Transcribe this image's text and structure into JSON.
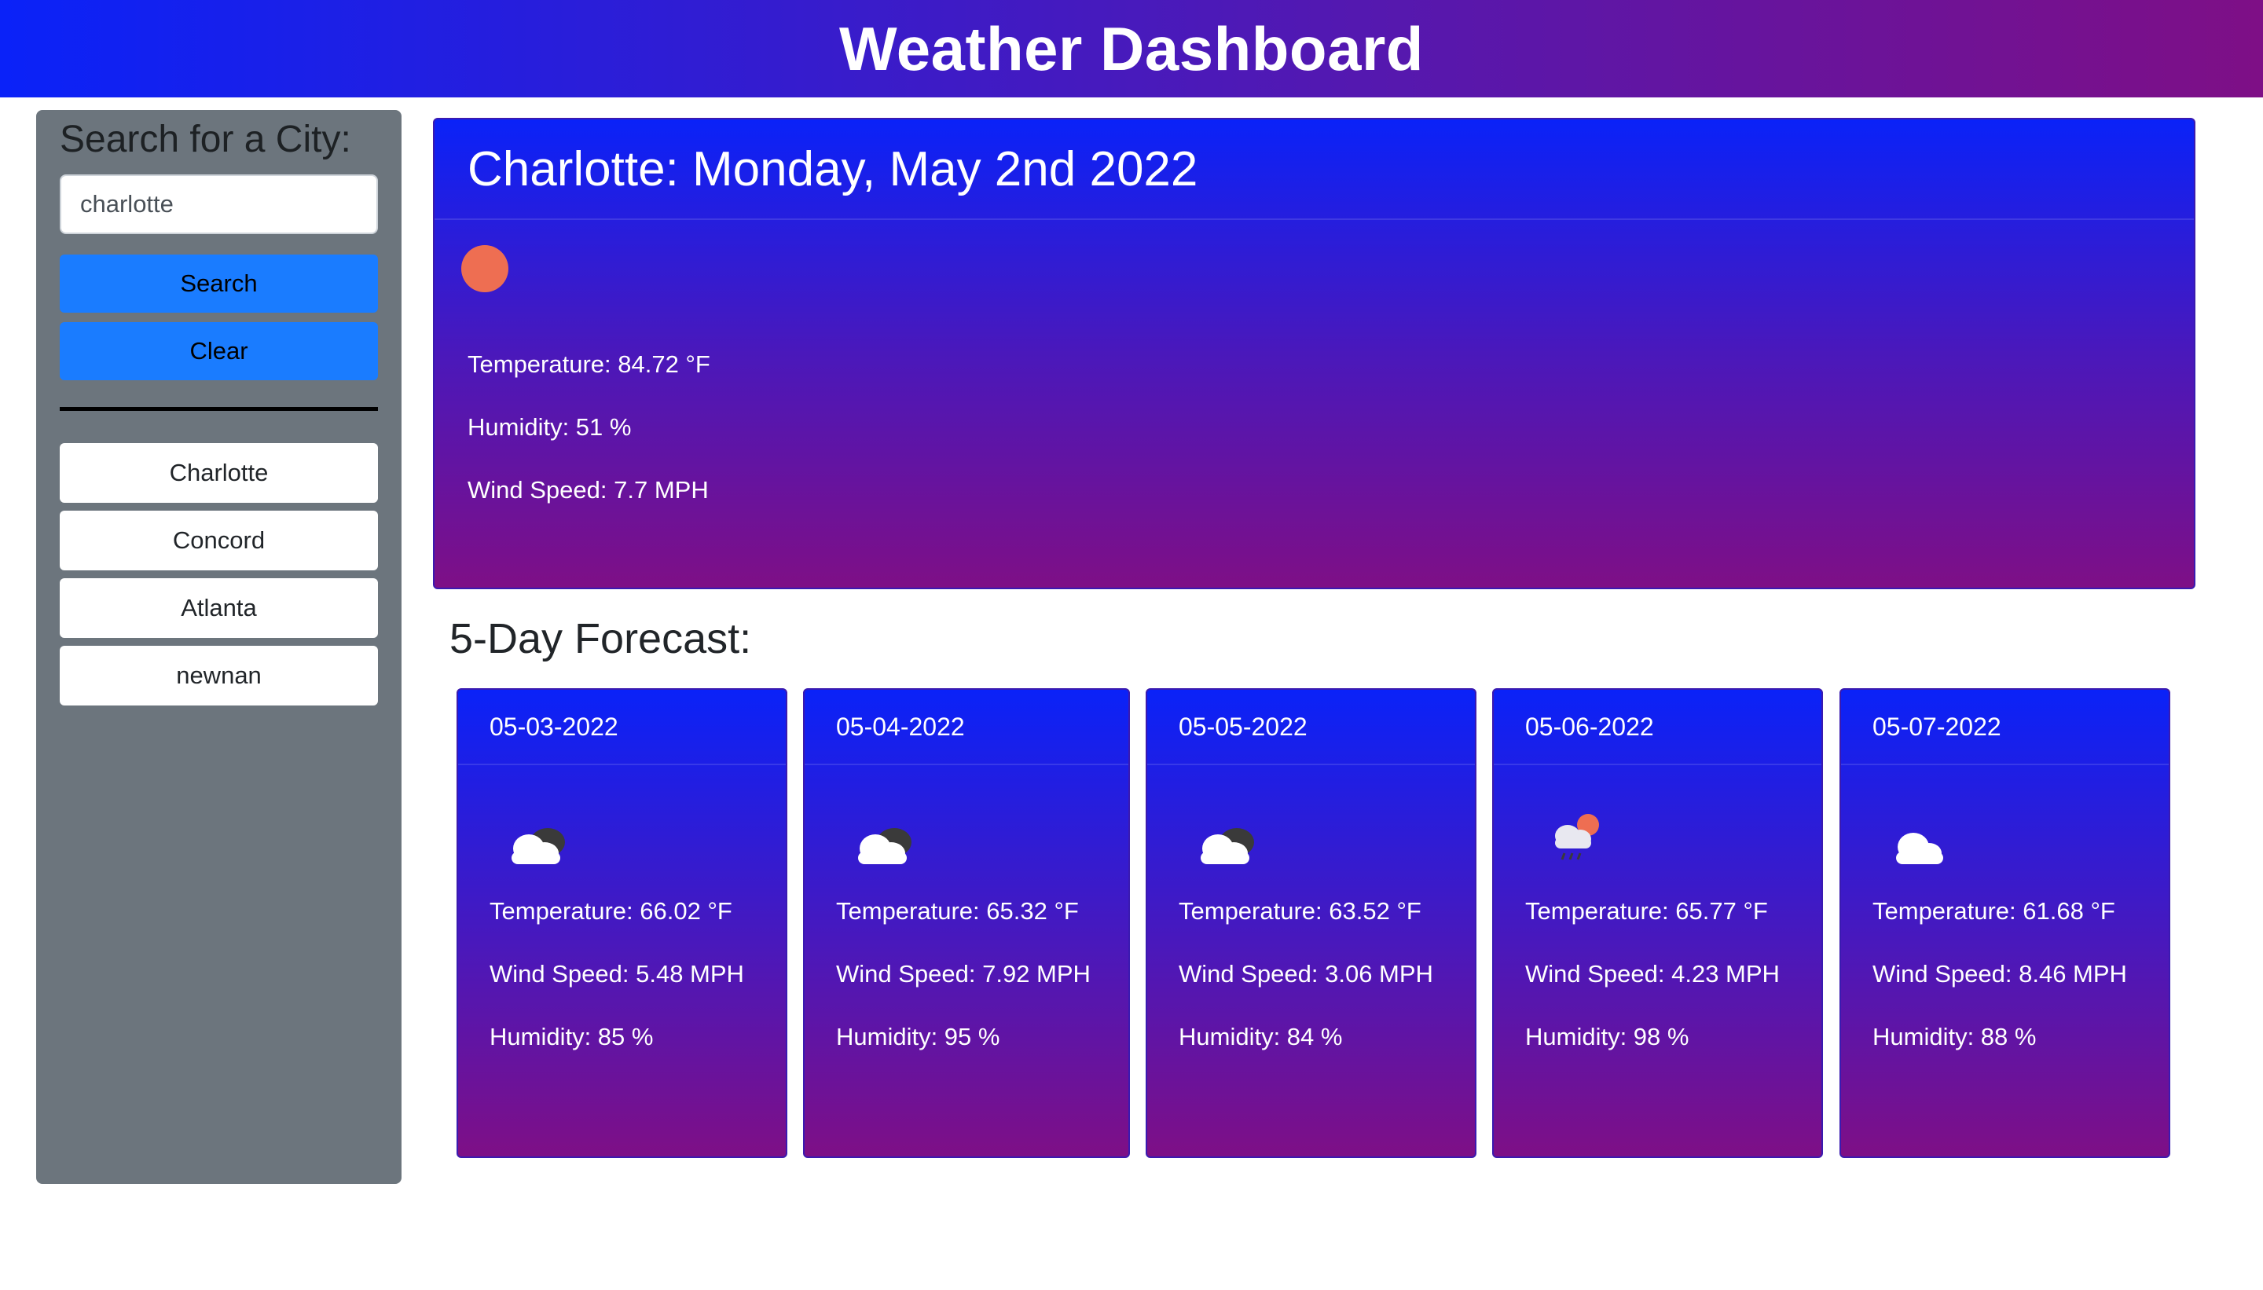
{
  "header": {
    "title": "Weather Dashboard"
  },
  "sidebar": {
    "label": "Search for a City:",
    "search_value": "charlotte",
    "search_button": "Search",
    "clear_button": "Clear",
    "history": [
      "Charlotte",
      "Concord",
      "Atlanta",
      "newnan"
    ]
  },
  "current": {
    "title": "Charlotte: Monday, May 2nd 2022",
    "icon": "clear-sky-sun-icon",
    "temperature": "Temperature: 84.72 °F",
    "humidity": "Humidity: 51 %",
    "wind": "Wind Speed: 7.7 MPH"
  },
  "forecast": {
    "title": "5-Day Forecast:",
    "days": [
      {
        "date": "05-03-2022",
        "icon": "broken-clouds-icon",
        "temperature": "Temperature: 66.02 °F",
        "wind": "Wind Speed: 5.48 MPH",
        "humidity": "Humidity: 85 %"
      },
      {
        "date": "05-04-2022",
        "icon": "broken-clouds-icon",
        "temperature": "Temperature: 65.32 °F",
        "wind": "Wind Speed: 7.92 MPH",
        "humidity": "Humidity: 95 %"
      },
      {
        "date": "05-05-2022",
        "icon": "broken-clouds-icon",
        "temperature": "Temperature: 63.52 °F",
        "wind": "Wind Speed: 3.06 MPH",
        "humidity": "Humidity: 84 %"
      },
      {
        "date": "05-06-2022",
        "icon": "rain-sun-icon",
        "temperature": "Temperature: 65.77 °F",
        "wind": "Wind Speed: 4.23 MPH",
        "humidity": "Humidity: 98 %"
      },
      {
        "date": "05-07-2022",
        "icon": "cloud-icon",
        "temperature": "Temperature: 61.68 °F",
        "wind": "Wind Speed: 8.46 MPH",
        "humidity": "Humidity: 88 %"
      }
    ]
  },
  "colors": {
    "header_gradient_start": "#0a22f8",
    "header_gradient_end": "#7e0f86",
    "sidebar_bg": "#6c757d",
    "button_blue": "#1a7cff",
    "sun": "#ee6e52"
  }
}
